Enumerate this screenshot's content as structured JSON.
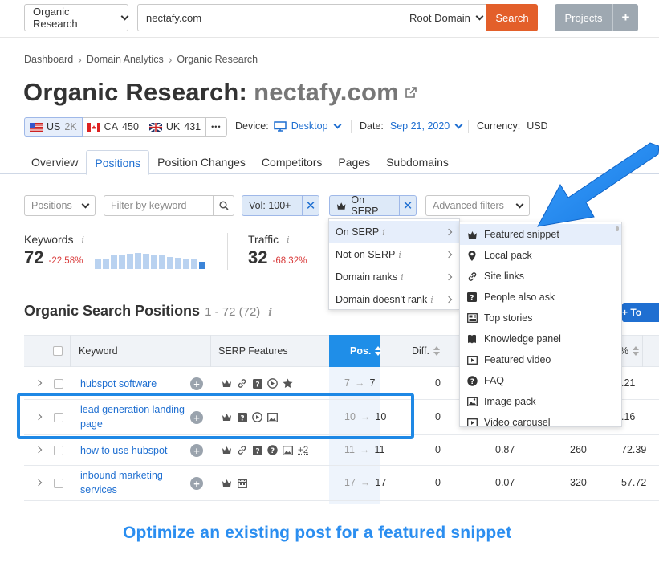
{
  "header": {
    "db_select": "Organic Research",
    "search_value": "nectafy.com",
    "scope_select": "Root Domain",
    "search_label": "Search",
    "projects_label": "Projects",
    "projects_plus": "+"
  },
  "breadcrumb": [
    "Dashboard",
    "Domain Analytics",
    "Organic Research"
  ],
  "title": {
    "prefix": "Organic Research:",
    "domain": "nectafy.com"
  },
  "databases": [
    {
      "code": "US",
      "count": "2K"
    },
    {
      "code": "CA",
      "count": "450"
    },
    {
      "code": "UK",
      "count": "431"
    }
  ],
  "more_label": "•••",
  "device": {
    "label": "Device:",
    "value": "Desktop"
  },
  "date": {
    "label": "Date:",
    "value": "Sep 21, 2020"
  },
  "currency": {
    "label": "Currency:",
    "value": "USD"
  },
  "tabs": [
    "Overview",
    "Positions",
    "Position Changes",
    "Competitors",
    "Pages",
    "Subdomains"
  ],
  "filters": {
    "positions": "Positions",
    "keyword_placeholder": "Filter by keyword",
    "volume": "Vol: 100+",
    "serp": "On SERP",
    "advanced": "Advanced filters"
  },
  "metrics": {
    "keywords": {
      "label": "Keywords",
      "value": "72",
      "delta": "-22.58%",
      "bar_levels": [
        0.6,
        0.6,
        0.75,
        0.8,
        0.85,
        0.9,
        0.85,
        0.8,
        0.75,
        0.7,
        0.65,
        0.6,
        0.55,
        0.4
      ]
    },
    "traffic": {
      "label": "Traffic",
      "value": "32",
      "delta": "-68.32%"
    }
  },
  "section": {
    "title": "Organic Search Positions",
    "range": "1 - 72 (72)",
    "to_label": "+ To"
  },
  "table": {
    "headers": {
      "keyword": "Keyword",
      "serp": "SERP Features",
      "pos": "Pos.",
      "diff": "Diff.",
      "pct": "%"
    },
    "rows": [
      {
        "keyword": "hubspot software",
        "from": "7",
        "to": "7",
        "diff": "0",
        "cpc": "",
        "vol": "",
        "pct": ".21",
        "icons": [
          "crown",
          "link",
          "question",
          "play",
          "star"
        ],
        "extra": ""
      },
      {
        "keyword": "lead generation landing page",
        "from": "10",
        "to": "10",
        "diff": "0",
        "cpc": "",
        "vol": "",
        "pct": ".16",
        "icons": [
          "crown",
          "question",
          "play",
          "image"
        ],
        "extra": ""
      },
      {
        "keyword": "how to use hubspot",
        "from": "11",
        "to": "11",
        "diff": "0",
        "cpc": "0.87",
        "vol": "260",
        "pct": "72.39",
        "icons": [
          "crown",
          "link",
          "question",
          "faq",
          "image"
        ],
        "extra": "+2"
      },
      {
        "keyword": "inbound marketing services",
        "from": "17",
        "to": "17",
        "diff": "0",
        "cpc": "0.07",
        "vol": "320",
        "pct": "57.72",
        "icons": [
          "crown",
          "calendar"
        ],
        "extra": ""
      }
    ]
  },
  "serp_menu": [
    "On SERP",
    "Not on SERP",
    "Domain ranks",
    "Domain doesn't rank"
  ],
  "submenu": [
    "Featured snippet",
    "Local pack",
    "Site links",
    "People also ask",
    "Top stories",
    "Knowledge panel",
    "Featured video",
    "FAQ",
    "Image pack",
    "Video carousel"
  ],
  "caption": "Optimize an existing post for a featured snippet",
  "colors": {
    "accent": "#1f6fd1",
    "search": "#e35f2a",
    "annotation": "#1e88e5",
    "negative": "#d93b3b"
  }
}
